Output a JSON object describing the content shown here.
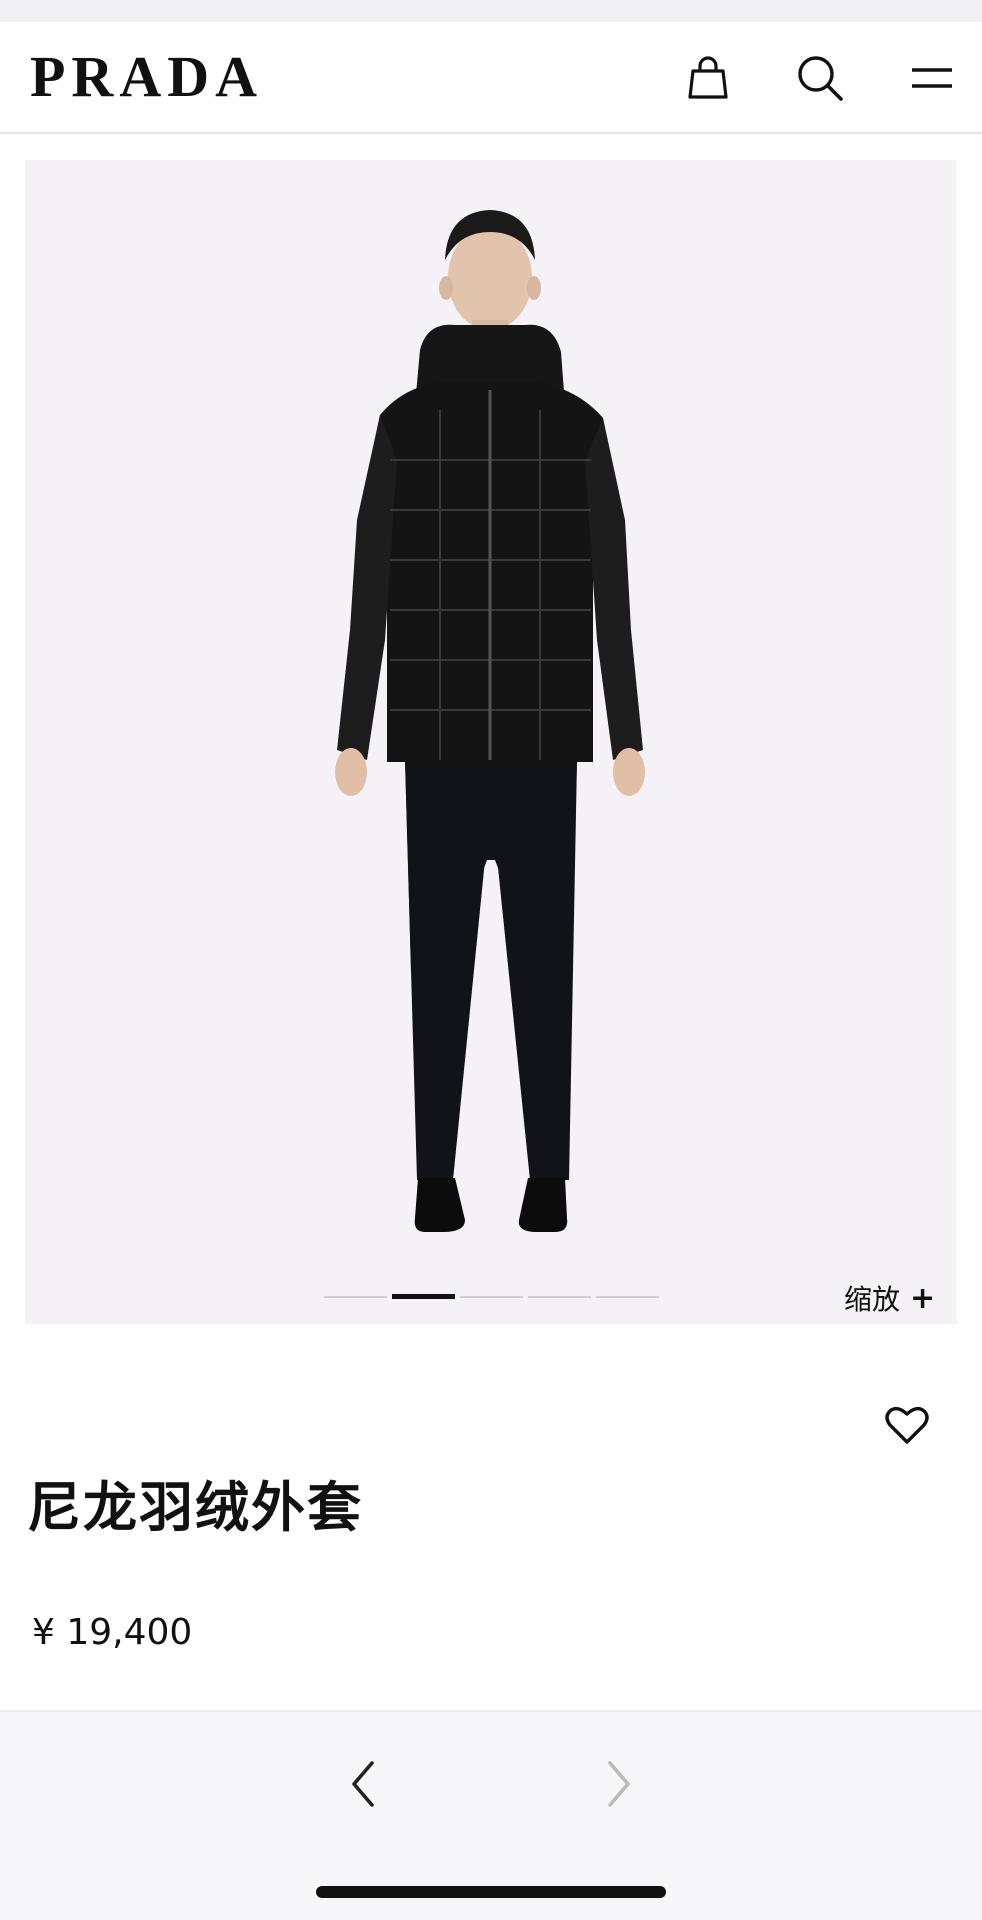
{
  "header": {
    "logo": "PRADA",
    "icons": [
      "shopping-bag-icon",
      "search-icon",
      "menu-icon"
    ]
  },
  "gallery": {
    "image_alt": "product-photo",
    "slide_count": 5,
    "active_slide": 2,
    "zoom_label": "缩放",
    "zoom_symbol": "+"
  },
  "product": {
    "title": "尼龙羽绒外套",
    "price": "¥ 19,400"
  },
  "bottom_nav": {
    "prev_icon": "chevron-left-icon",
    "next_icon": "chevron-right-icon"
  },
  "colors": {
    "accent": "#111111",
    "image_background": "#f4f2f6",
    "disabled_arrow": "#b9b9be"
  }
}
